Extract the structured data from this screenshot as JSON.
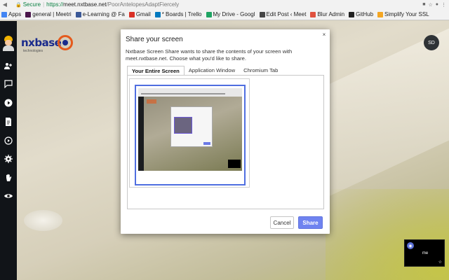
{
  "browser": {
    "secure_label": "Secure",
    "url_scheme": "https://",
    "url_host": "meet.nxtbase.net",
    "url_path": "/PoorAntelopesAdaptFiercely",
    "bookmarks": [
      {
        "label": "Apps",
        "icon": "apps-grid-icon",
        "color": "#4285f4"
      },
      {
        "label": "general | Meetri",
        "icon": "slack-icon",
        "color": "#4a154b"
      },
      {
        "label": "e-Learning @ Fa",
        "icon": "elearning-icon",
        "color": "#3b5998"
      },
      {
        "label": "Gmail",
        "icon": "gmail-icon",
        "color": "#d93025"
      },
      {
        "label": "* Boards | Trello",
        "icon": "trello-icon",
        "color": "#0079bf"
      },
      {
        "label": "My Drive - Googl",
        "icon": "google-drive-icon",
        "color": "#1fa463"
      },
      {
        "label": "Edit Post ‹ Meet",
        "icon": "wordpress-icon",
        "color": "#464646"
      },
      {
        "label": "Blur Admin",
        "icon": "blur-admin-icon",
        "color": "#e0523f"
      },
      {
        "label": "GitHub",
        "icon": "github-icon",
        "color": "#222222"
      },
      {
        "label": "Simplify Your SSL",
        "icon": "ssl-icon",
        "color": "#f4a623"
      }
    ]
  },
  "brand": {
    "name": "nxbase",
    "tagline": "technologies"
  },
  "user": {
    "initials": "SD"
  },
  "self_view": {
    "name": "me"
  },
  "dialog": {
    "title": "Share your screen",
    "description": "Nxtbase Screen Share wants to share the contents of your screen with meet.nxtbase.net. Choose what you'd like to share.",
    "tabs": [
      {
        "label": "Your Entire Screen",
        "active": true
      },
      {
        "label": "Application Window",
        "active": false
      },
      {
        "label": "Chromium Tab",
        "active": false
      }
    ],
    "cancel_label": "Cancel",
    "share_label": "Share",
    "close_glyph": "×"
  },
  "colors": {
    "accent": "#6f83f0",
    "selection_border": "#4f6ee0",
    "secure_green": "#0b8043",
    "sidebar_bg": "#111418"
  }
}
